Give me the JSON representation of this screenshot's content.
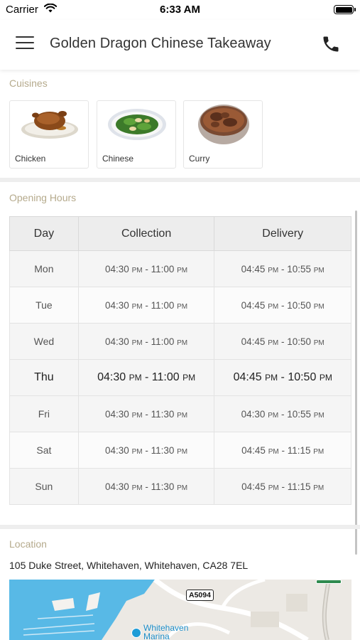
{
  "status_bar": {
    "carrier": "Carrier",
    "time": "6:33 AM"
  },
  "header": {
    "title": "Golden Dragon Chinese Takeaway",
    "menu_icon": "hamburger-menu-icon",
    "phone_icon": "phone-icon"
  },
  "cuisines": {
    "label": "Cuisines",
    "items": [
      {
        "name": "Chicken"
      },
      {
        "name": "Chinese"
      },
      {
        "name": "Curry"
      }
    ]
  },
  "opening_hours": {
    "label": "Opening Hours",
    "columns": [
      "Day",
      "Collection",
      "Delivery"
    ],
    "rows": [
      {
        "day": "Mon",
        "collection": {
          "open": "04:30",
          "open_ampm": "PM",
          "close": "11:00",
          "close_ampm": "PM"
        },
        "delivery": {
          "open": "04:45",
          "open_ampm": "PM",
          "close": "10:55",
          "close_ampm": "PM"
        }
      },
      {
        "day": "Tue",
        "collection": {
          "open": "04:30",
          "open_ampm": "PM",
          "close": "11:00",
          "close_ampm": "PM"
        },
        "delivery": {
          "open": "04:45",
          "open_ampm": "PM",
          "close": "10:50",
          "close_ampm": "PM"
        }
      },
      {
        "day": "Wed",
        "collection": {
          "open": "04:30",
          "open_ampm": "PM",
          "close": "11:00",
          "close_ampm": "PM"
        },
        "delivery": {
          "open": "04:45",
          "open_ampm": "PM",
          "close": "10:50",
          "close_ampm": "PM"
        }
      },
      {
        "day": "Thu",
        "collection": {
          "open": "04:30",
          "open_ampm": "PM",
          "close": "11:00",
          "close_ampm": "PM"
        },
        "delivery": {
          "open": "04:45",
          "open_ampm": "PM",
          "close": "10:50",
          "close_ampm": "PM"
        }
      },
      {
        "day": "Fri",
        "collection": {
          "open": "04:30",
          "open_ampm": "PM",
          "close": "11:30",
          "close_ampm": "PM"
        },
        "delivery": {
          "open": "04:30",
          "open_ampm": "PM",
          "close": "10:55",
          "close_ampm": "PM"
        }
      },
      {
        "day": "Sat",
        "collection": {
          "open": "04:30",
          "open_ampm": "PM",
          "close": "11:30",
          "close_ampm": "PM"
        },
        "delivery": {
          "open": "04:45",
          "open_ampm": "PM",
          "close": "11:15",
          "close_ampm": "PM"
        }
      },
      {
        "day": "Sun",
        "collection": {
          "open": "04:30",
          "open_ampm": "PM",
          "close": "11:30",
          "close_ampm": "PM"
        },
        "delivery": {
          "open": "04:45",
          "open_ampm": "PM",
          "close": "11:15",
          "close_ampm": "PM"
        }
      }
    ]
  },
  "location": {
    "label": "Location",
    "address": "105 Duke Street, Whitehaven, Whitehaven, CA28 7EL",
    "map": {
      "road_sign": "A5094",
      "place_label_line1": "Whitehaven",
      "place_label_line2": "Marina"
    }
  },
  "colors": {
    "section_label": "#b5aa8c",
    "map_water": "#58b9e6",
    "map_land": "#ece9e4",
    "map_pin": "#1e9cd7"
  }
}
